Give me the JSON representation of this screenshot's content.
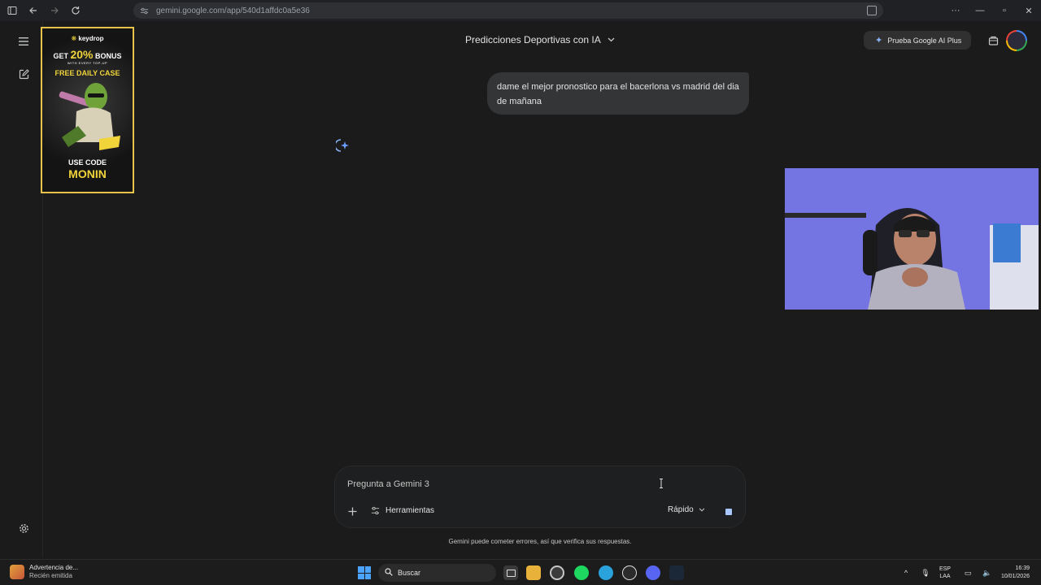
{
  "browser": {
    "url": "gemini.google.com/app/540d1affdc0a5e36",
    "back_icon": "arrow-left-icon",
    "forward_icon": "arrow-right-icon",
    "reload_icon": "reload-icon"
  },
  "header": {
    "chat_title": "Predicciones Deportivas con IA",
    "upgrade_label": "Prueba Google AI Plus"
  },
  "ad": {
    "brand": "keydrop",
    "line1_pre": "GET ",
    "line1_bold": "20%",
    "line1_post": " BONUS",
    "line2": "WITH EVERY TOP-UP",
    "line3": "FREE DAILY CASE",
    "line4": "USE CODE",
    "line5": "MONIN"
  },
  "chat": {
    "user_message": "dame el mejor pronostico para el bacerlona vs madrid del dia de mañana"
  },
  "composer": {
    "placeholder": "Pregunta a Gemini 3",
    "tools_label": "Herramientas",
    "mode_label": "Rápido",
    "disclaimer": "Gemini puede cometer errores, así que verifica sus respuestas."
  },
  "taskbar": {
    "notification_title": "Advertencia de...",
    "notification_sub": "Recién emitida",
    "search_label": "Buscar",
    "lang_top": "ESP",
    "lang_bottom": "LAA",
    "time": "16:39",
    "date": "10/01/2026"
  },
  "colors": {
    "background": "#1b1b1b",
    "bubble": "#333537",
    "accent": "#8ab4f8",
    "ad_yellow": "#f0d43a"
  }
}
